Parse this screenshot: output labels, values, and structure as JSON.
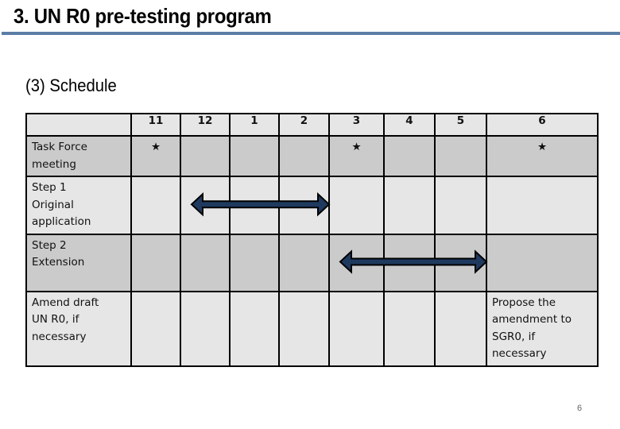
{
  "slide": {
    "title": "3. UN R0 pre-testing program",
    "subtitle": "(3) Schedule",
    "page_number": "6"
  },
  "schedule": {
    "months": [
      "11",
      "12",
      "1",
      "2",
      "3",
      "4",
      "5",
      "6"
    ],
    "rows": [
      {
        "label_lines": [
          "Task Force",
          "meeting"
        ],
        "milestones": [
          "11",
          "3",
          "6"
        ],
        "marker_icon": "star-icon",
        "marker_glyph": "★"
      },
      {
        "label_lines": [
          "Step 1",
          "Original",
          "application"
        ],
        "span": {
          "from": "12",
          "to": "2"
        }
      },
      {
        "label_lines": [
          "Step 2",
          "Extension"
        ],
        "span": {
          "from": "3",
          "to": "5"
        }
      },
      {
        "label_lines": [
          "Amend draft",
          "UN R0, if",
          "necessary"
        ],
        "note_month": "6",
        "note_lines": [
          "Propose the",
          "amendment to",
          "SGR0, if necessary"
        ]
      }
    ]
  },
  "colors": {
    "header_rule": "#5b7ea6",
    "arrow_fill": "#1f3a5f",
    "row_dark": "#cbcbcb",
    "row_light": "#e6e6e6"
  }
}
